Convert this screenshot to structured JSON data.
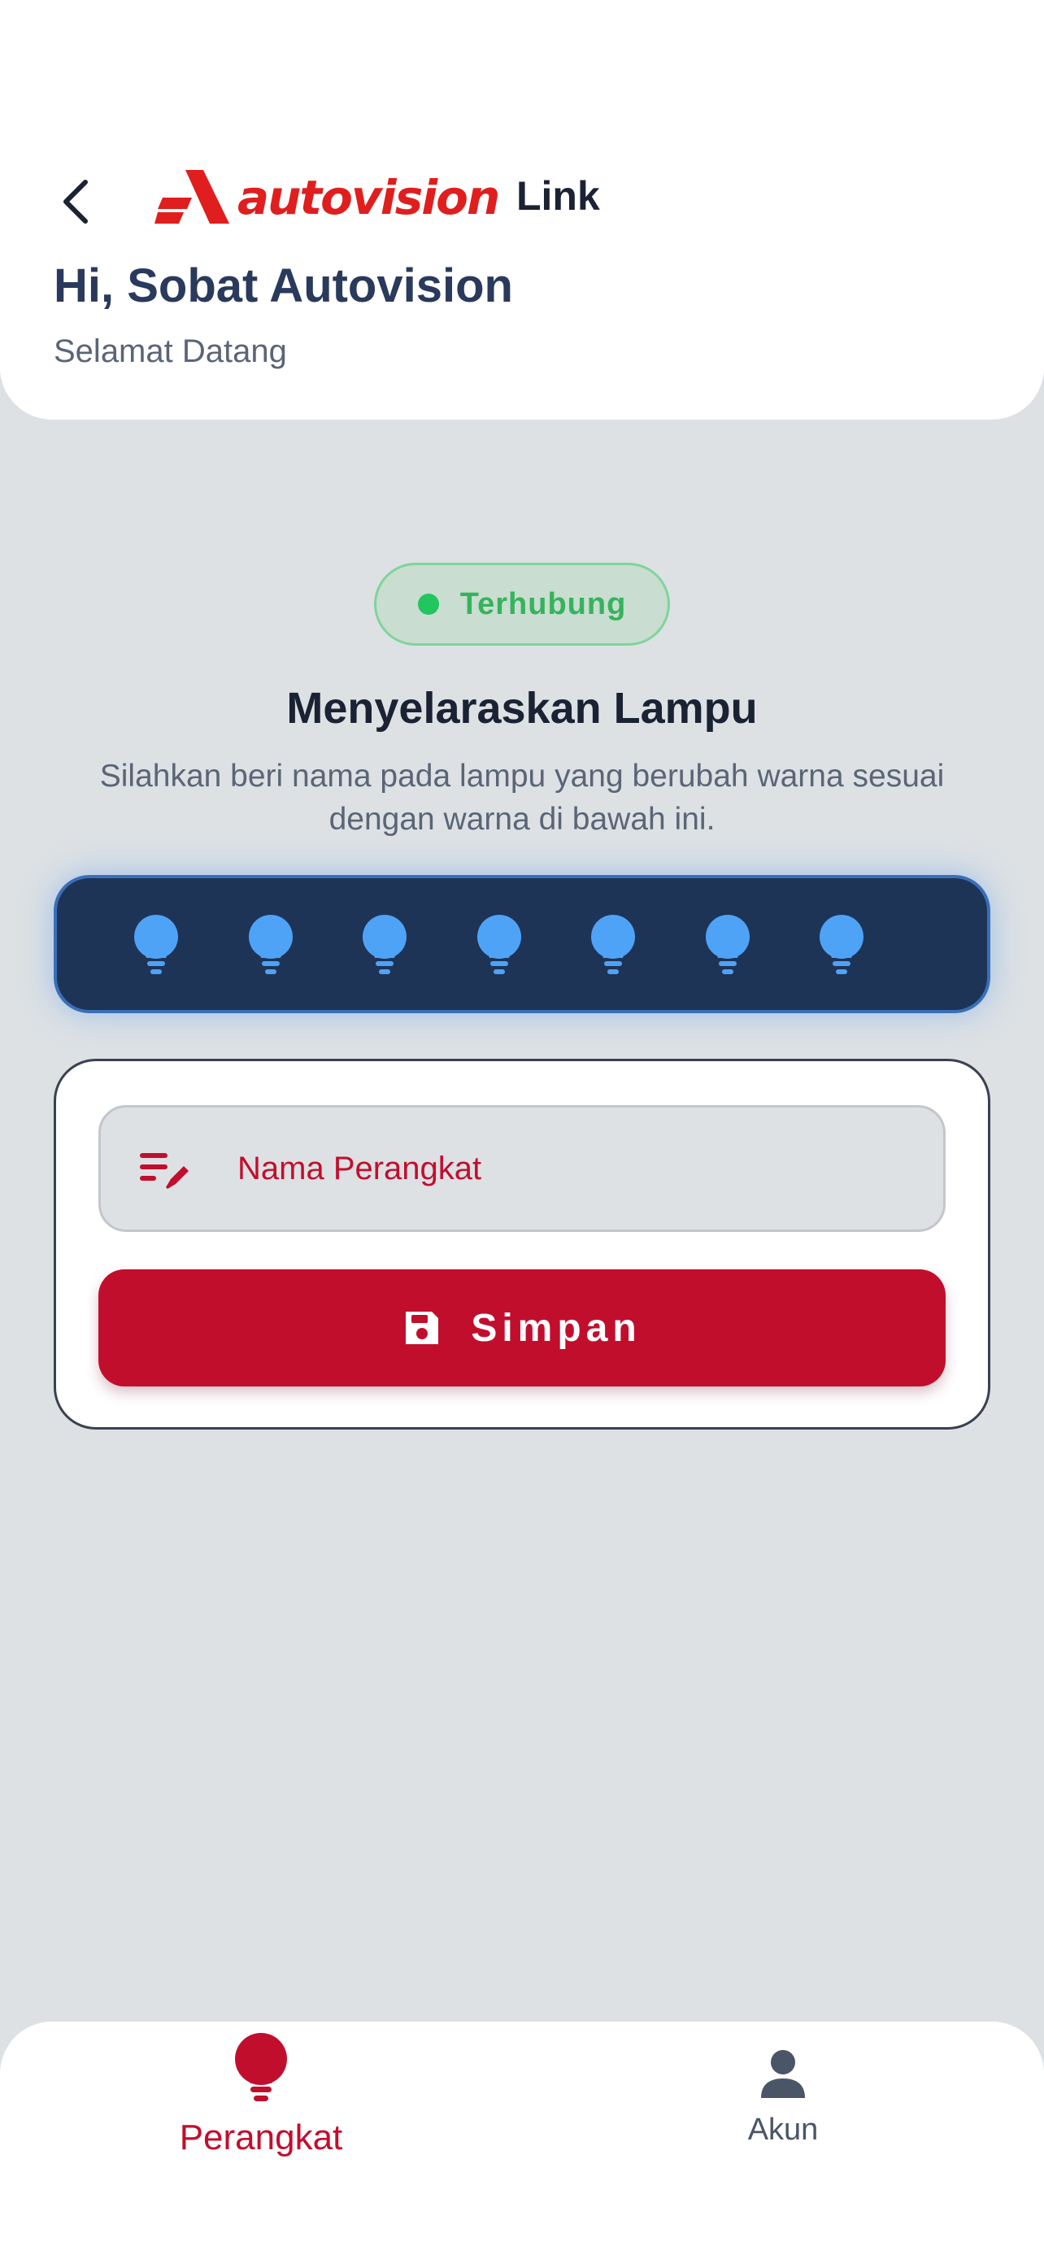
{
  "header": {
    "logo_text": "autovision",
    "logo_suffix": "Link",
    "greeting": "Hi, Sobat Autovision",
    "subgreeting": "Selamat Datang"
  },
  "status": {
    "label": "Terhubung",
    "color": "#22c55e"
  },
  "sync": {
    "title": "Menyelaraskan Lampu",
    "description": "Silahkan beri nama pada lampu yang berubah warna sesuai dengan warna di bawah ini.",
    "bulb_color": "#4fa3f7",
    "bulbs": [
      "bulb",
      "bulb",
      "bulb",
      "bulb",
      "bulb",
      "bulb",
      "bulb"
    ]
  },
  "form": {
    "name_placeholder": "Nama Perangkat",
    "name_value": "",
    "input_icon": "edit-list-icon",
    "save_label": "Simpan",
    "save_icon": "save-icon",
    "accent": "#c20e2d"
  },
  "nav": {
    "items": [
      {
        "label": "Perangkat",
        "icon": "bulb-icon",
        "active": true
      },
      {
        "label": "Akun",
        "icon": "user-icon",
        "active": false
      }
    ]
  }
}
